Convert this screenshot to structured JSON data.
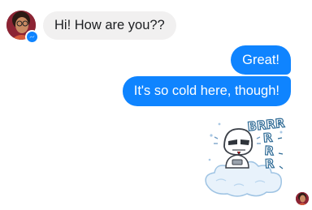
{
  "messages": [
    {
      "direction": "incoming",
      "text": "Hi! How are you??"
    },
    {
      "direction": "outgoing",
      "text": "Great!"
    },
    {
      "direction": "outgoing",
      "text": "It's so cold here, though!"
    }
  ],
  "sticker": {
    "text": "BRRR"
  },
  "icons": {
    "sender_avatar": "profile-photo",
    "platform_badge": "messenger-icon",
    "sticker": "cold-stormtrooper-sticker",
    "read_receipt": "seen-avatar"
  },
  "colors": {
    "outgoing_bubble": "#0f84ff",
    "incoming_bubble": "#f1f0f0",
    "badge": "#0f84ff"
  }
}
